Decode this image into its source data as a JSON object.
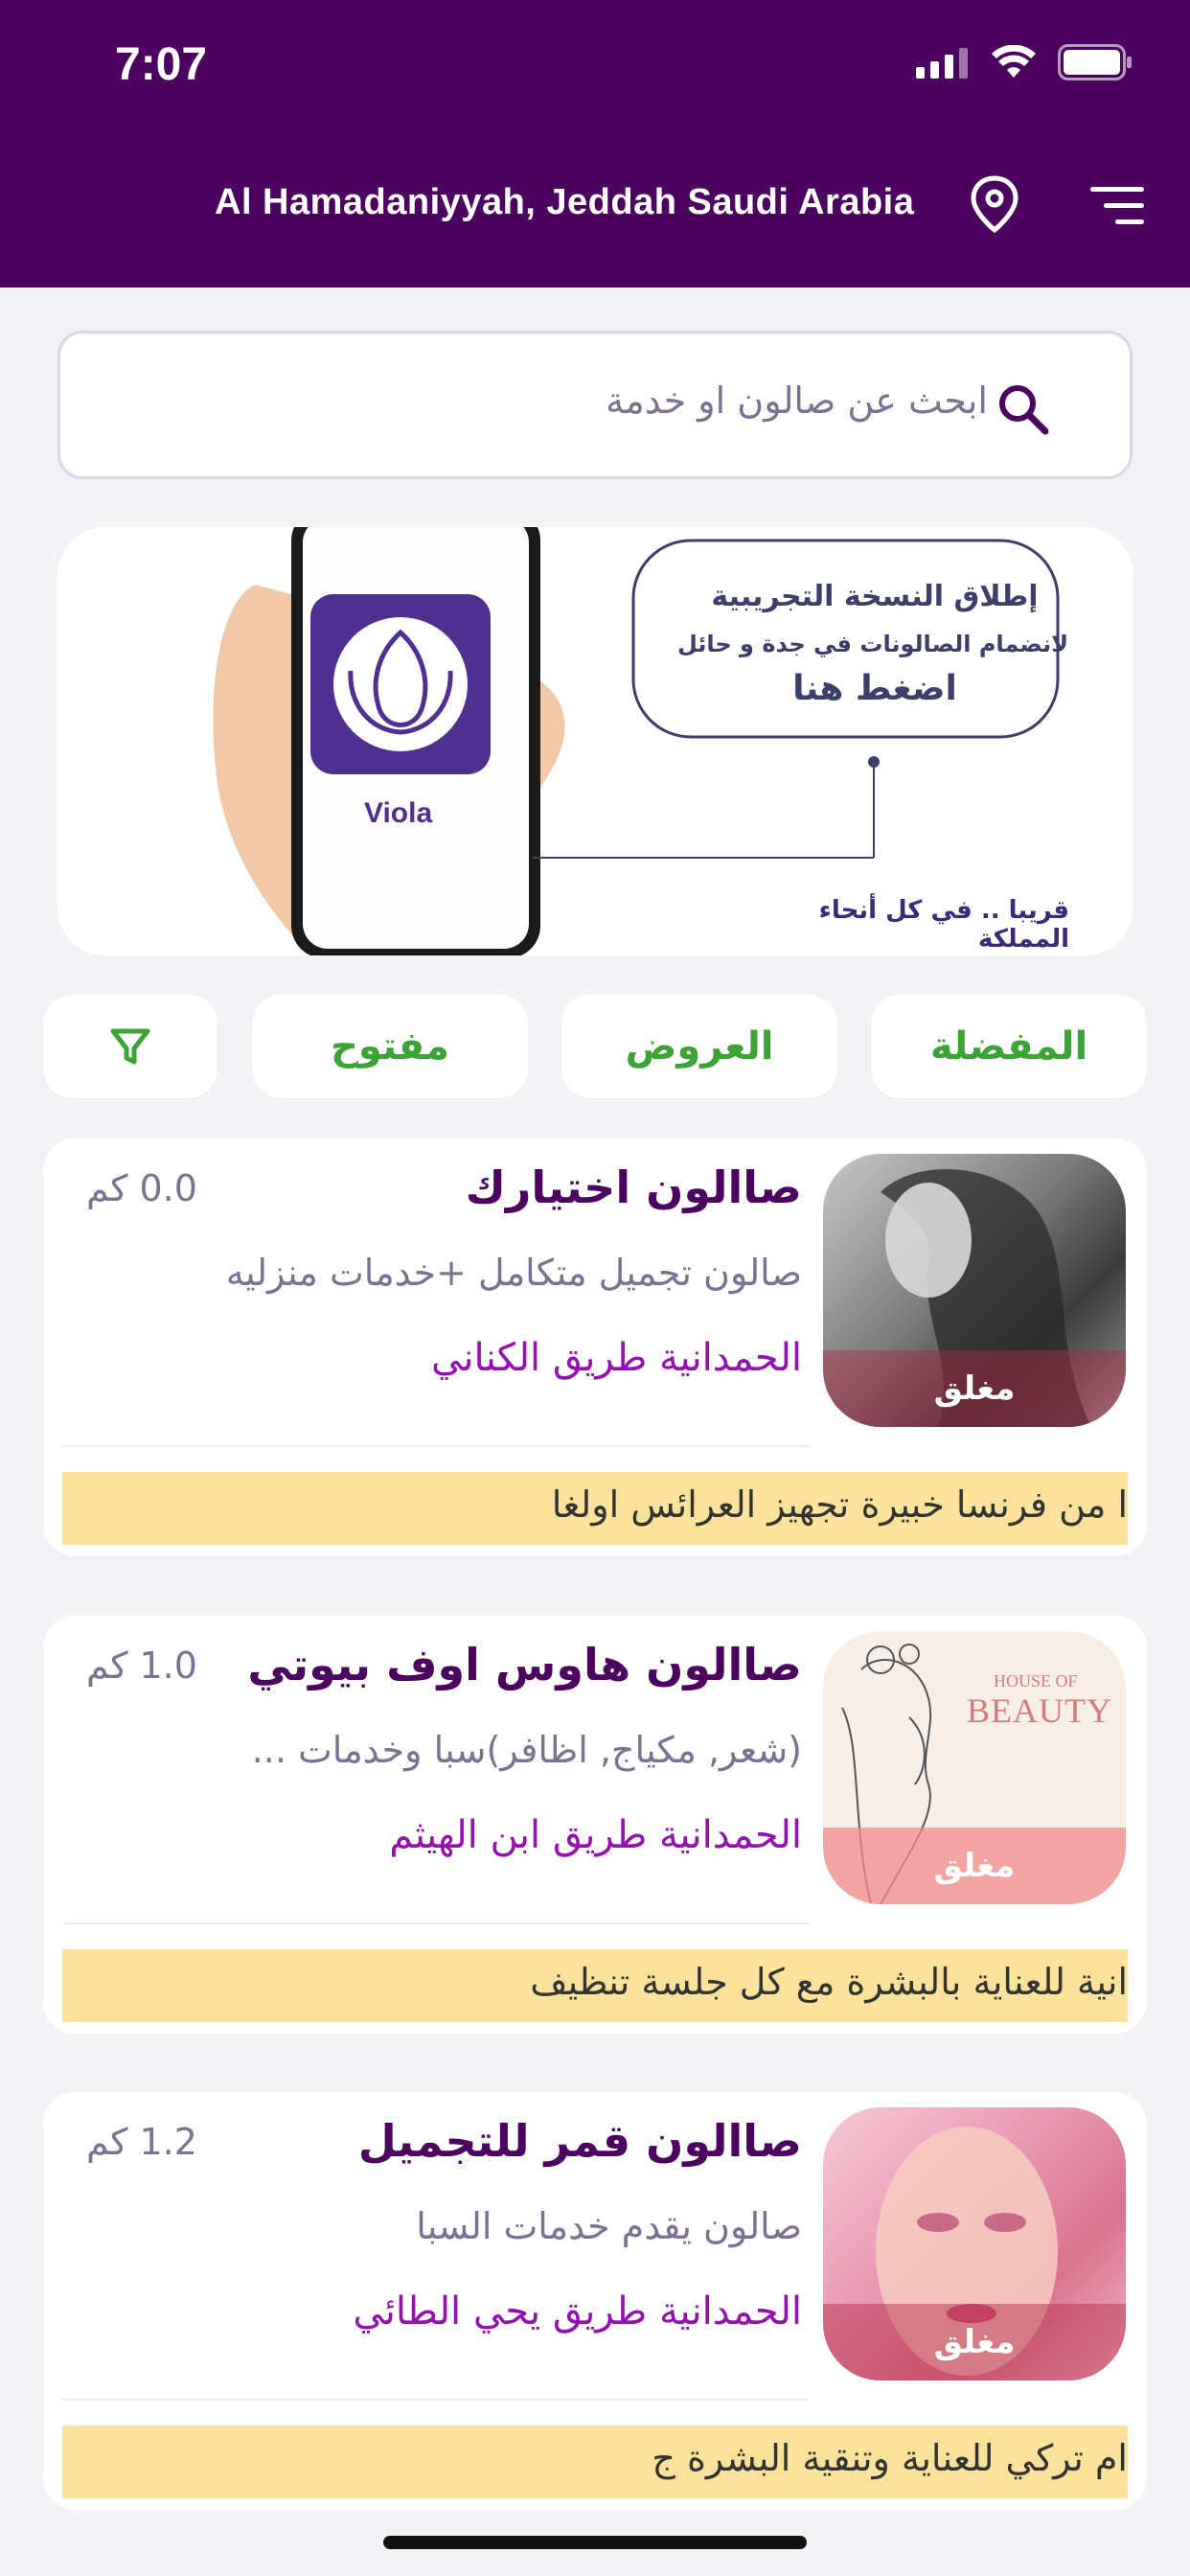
{
  "status_bar": {
    "time": "7:07"
  },
  "header": {
    "location": "Al Hamadaniyyah, Jeddah Saudi Arabia",
    "pin_icon": "location-pin-icon",
    "menu_icon": "menu-icon"
  },
  "search": {
    "placeholder": "ابحث عن صالون او خدمة"
  },
  "banner": {
    "app_name": "Viola",
    "line1": "إطلاق النسخة التجريبية",
    "line2": "لانضمام الصالونات في جدة و حائل",
    "cta": "اضغط هنا",
    "caption": "قريبا .. في كل أنحاء المملكة"
  },
  "filters": {
    "favorites": "المفضلة",
    "offers": "العروض",
    "open": "مفتوح",
    "filter_icon": "filter-funnel-icon"
  },
  "salons": [
    {
      "name": "صاالون اختيارك",
      "distance": "0.0 كم",
      "description": "صالون تجميل متكامل +خدمات منزليه",
      "address": "الحمدانية طريق الكناني",
      "status": "مغلق",
      "ticker": "ا من فرنسا خبيرة تجهيز العرائس اولغا"
    },
    {
      "name": "صاالون هاوس اوف بيوتي",
      "distance": "1.0 كم",
      "description": "(شعر, مكياج, اظافر)سبا وخدمات ...",
      "address": "الحمدانية طريق ابن الهيثم",
      "status": "مغلق",
      "photo_text_1": "HOUSE OF",
      "photo_text_2": "BEAUTY",
      "ticker": "انية للعناية بالبشرة مع كل جلسة تنظيف"
    },
    {
      "name": "صاالون قمر للتجميل",
      "distance": "1.2 كم",
      "description": "صالون يقدم خدمات السبا",
      "address": "الحمدانية طريق يحي الطائي",
      "status": "مغلق",
      "ticker": "ام تركي للعناية وتنقية البشرة ج"
    }
  ]
}
